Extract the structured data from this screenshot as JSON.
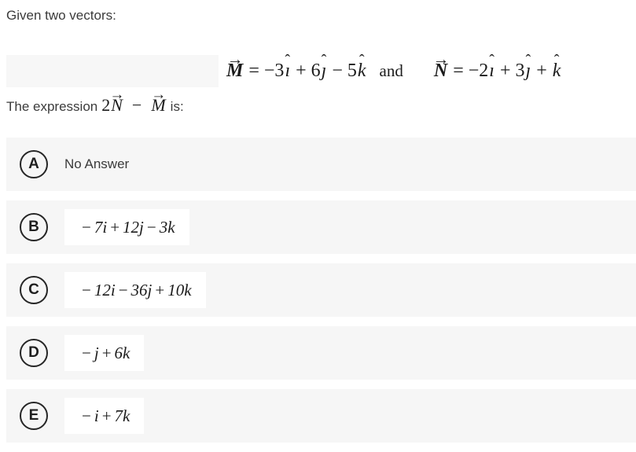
{
  "question": {
    "intro": "Given two vectors:",
    "vector_m": {
      "name": "M",
      "accent": "arrow",
      "equals": "=",
      "expression": "−3ı̂ + 6ĵ − 5k̂",
      "terms": [
        {
          "coef": "−3",
          "unit": "i",
          "hat": true
        },
        {
          "sign": "+",
          "coef": "6",
          "unit": "j",
          "hat": true
        },
        {
          "sign": "−",
          "coef": "5",
          "unit": "k",
          "hat": true
        }
      ]
    },
    "conjunction": "and",
    "vector_n": {
      "name": "N",
      "accent": "arrow",
      "equals": "=",
      "expression": "−2ı̂ + 3ĵ + k̂",
      "terms": [
        {
          "coef": "−2",
          "unit": "i",
          "hat": true
        },
        {
          "sign": "+",
          "coef": "3",
          "unit": "j",
          "hat": true
        },
        {
          "sign": "+",
          "coef": "",
          "unit": "k",
          "hat": true
        }
      ]
    },
    "prompt_prefix": "The expression",
    "prompt_math": "2N⃗ − M⃗",
    "prompt_suffix": "is:"
  },
  "options": [
    {
      "letter": "A",
      "kind": "text",
      "label": "No Answer"
    },
    {
      "letter": "B",
      "kind": "math",
      "label": "− 7i + 12j − 3k",
      "parts": [
        {
          "op": "−",
          "coef": "7",
          "unit": "i"
        },
        {
          "op": "+",
          "coef": "12",
          "unit": "j"
        },
        {
          "op": "−",
          "coef": "3",
          "unit": "k"
        }
      ]
    },
    {
      "letter": "C",
      "kind": "math",
      "label": "− 12i − 36j + 10k",
      "parts": [
        {
          "op": "−",
          "coef": "12",
          "unit": "i"
        },
        {
          "op": "−",
          "coef": "36",
          "unit": "j"
        },
        {
          "op": "+",
          "coef": "10",
          "unit": "k"
        }
      ]
    },
    {
      "letter": "D",
      "kind": "math",
      "label": "− j + 6k",
      "parts": [
        {
          "op": "−",
          "coef": "",
          "unit": "j"
        },
        {
          "op": "+",
          "coef": "6",
          "unit": "k"
        }
      ]
    },
    {
      "letter": "E",
      "kind": "math",
      "label": "− i + 7k",
      "parts": [
        {
          "op": "−",
          "coef": "",
          "unit": "i"
        },
        {
          "op": "+",
          "coef": "7",
          "unit": "k"
        }
      ]
    }
  ],
  "colors": {
    "page_background": "#ffffff",
    "row_background": "#f6f6f6",
    "math_box_background": "#ffffff",
    "text": "#3b3b3b",
    "math_text": "#1b1b1b",
    "badge_border": "#262626"
  }
}
